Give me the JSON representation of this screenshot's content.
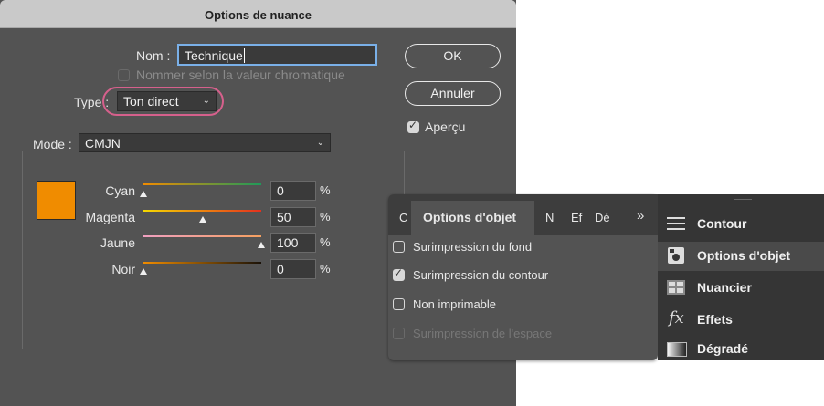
{
  "dialog": {
    "title": "Options de nuance",
    "name_label": "Nom :",
    "name_value": "Technique",
    "name_by_value": "Nommer selon la valeur chromatique",
    "type_label": "Type :",
    "type_value": "Ton direct",
    "ok_label": "OK",
    "cancel_label": "Annuler",
    "preview_label": "Aperçu",
    "mode_label": "Mode :",
    "mode_value": "CMJN",
    "swatch_color": "#f08c00",
    "highlight_color": "#d6608c",
    "sliders": [
      {
        "label": "Cyan",
        "value": "0",
        "unit": "%",
        "level": 0,
        "gradient": "linear-gradient(90deg,#f08c00,#1e9a5a)"
      },
      {
        "label": "Magenta",
        "value": "50",
        "unit": "%",
        "level": 0.5,
        "gradient": "linear-gradient(90deg,#f5d800,#e4301e)"
      },
      {
        "label": "Jaune",
        "value": "100",
        "unit": "%",
        "level": 1,
        "gradient": "linear-gradient(90deg,#f0a0c0,#f5a060)"
      },
      {
        "label": "Noir",
        "value": "0",
        "unit": "%",
        "level": 0,
        "gradient": "linear-gradient(90deg,#f08c00,#1a1208)"
      }
    ]
  },
  "panel": {
    "tabs_left": "C",
    "active_tab": "Options d'objet",
    "tabs_right": [
      "N",
      "Ef",
      "Dé"
    ],
    "overflow": "»",
    "items": [
      {
        "label": "Surimpression du fond",
        "state": "off"
      },
      {
        "label": "Surimpression du contour",
        "state": "on"
      },
      {
        "label": "Non imprimable",
        "state": "off"
      },
      {
        "label": "Surimpression de l'espace",
        "state": "disabled"
      }
    ]
  },
  "side": {
    "items": [
      {
        "label": "Contour",
        "icon": "lines-icon"
      },
      {
        "label": "Options d'objet",
        "icon": "object-options-icon"
      },
      {
        "label": "Nuancier",
        "icon": "swatches-icon"
      },
      {
        "label": "Effets",
        "icon": "fx-icon"
      },
      {
        "label": "Dégradé",
        "icon": "gradient-icon"
      }
    ]
  }
}
